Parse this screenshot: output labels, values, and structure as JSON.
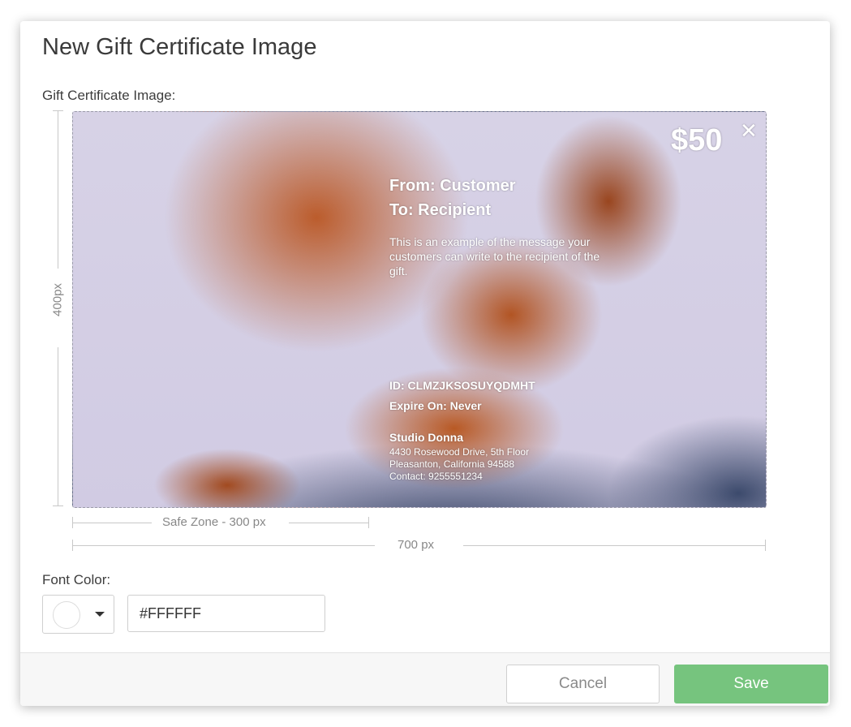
{
  "modal": {
    "title": "New Gift Certificate Image",
    "image_label": "Gift Certificate Image:",
    "font_color_label": "Font Color:"
  },
  "rulers": {
    "height_label": "400px",
    "safe_zone_label": "Safe Zone - 300 px",
    "width_label": "700 px"
  },
  "certificate": {
    "amount": "$50",
    "close_icon": "close-icon",
    "from": "From: Customer",
    "to": "To: Recipient",
    "message": "This is an example of the message your customers can write to the recipient of the gift.",
    "id": "ID: CLMZJKSOSUYQDMHT",
    "expire": "Expire On: Never",
    "business_name": "Studio Donna",
    "address_line1": "4430 Rosewood Drive, 5th Floor",
    "address_line2": "Pleasanton, California 94588",
    "contact": "Contact: 9255551234"
  },
  "font_color": {
    "value": "#FFFFFF",
    "display": "#FFFFFF"
  },
  "footer": {
    "cancel_label": "Cancel",
    "save_label": "Save"
  },
  "colors": {
    "save_button": "#76c47e",
    "text_color": "#FFFFFF"
  }
}
